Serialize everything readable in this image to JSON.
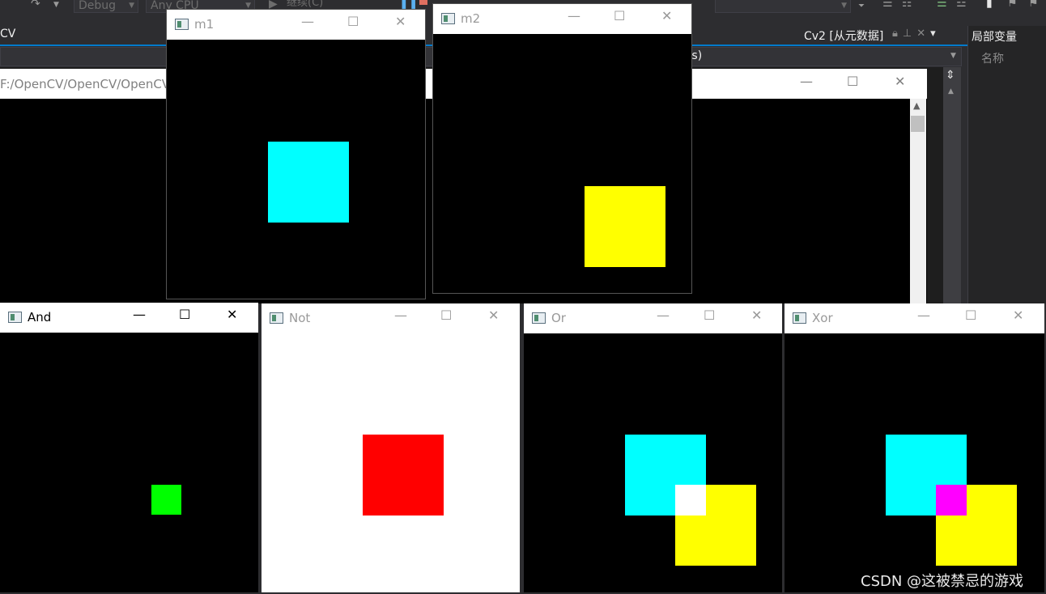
{
  "toolbar": {
    "config_label": "Debug",
    "platform_label": "Any CPU",
    "continue_label": "继续(C)"
  },
  "vs": {
    "left_tab": "CV",
    "doc_tab": "Cv2 [从元数据]",
    "nav_text": "rgs)",
    "right_panel_title": "局部变量",
    "right_panel_column": "名称"
  },
  "console": {
    "path": "F:/OpenCV/OpenCV/OpenCV"
  },
  "window_controls": {
    "minimize": "—",
    "maximize": "☐",
    "close": "✕"
  },
  "windows": {
    "m1": {
      "title": "m1",
      "active": false
    },
    "m2": {
      "title": "m2",
      "active": false
    },
    "and": {
      "title": "And",
      "active": true
    },
    "not": {
      "title": "Not",
      "active": false
    },
    "or": {
      "title": "Or",
      "active": false
    },
    "xor": {
      "title": "Xor",
      "active": false
    }
  },
  "colors": {
    "cyan": "#00ffff",
    "yellow": "#ffff00",
    "green": "#00ff00",
    "red": "#ff0000",
    "white": "#ffffff",
    "magenta": "#ff00ff",
    "black": "#000000",
    "vs_accent": "#007acc"
  },
  "watermark": "CSDN @这被禁忌的游戏"
}
